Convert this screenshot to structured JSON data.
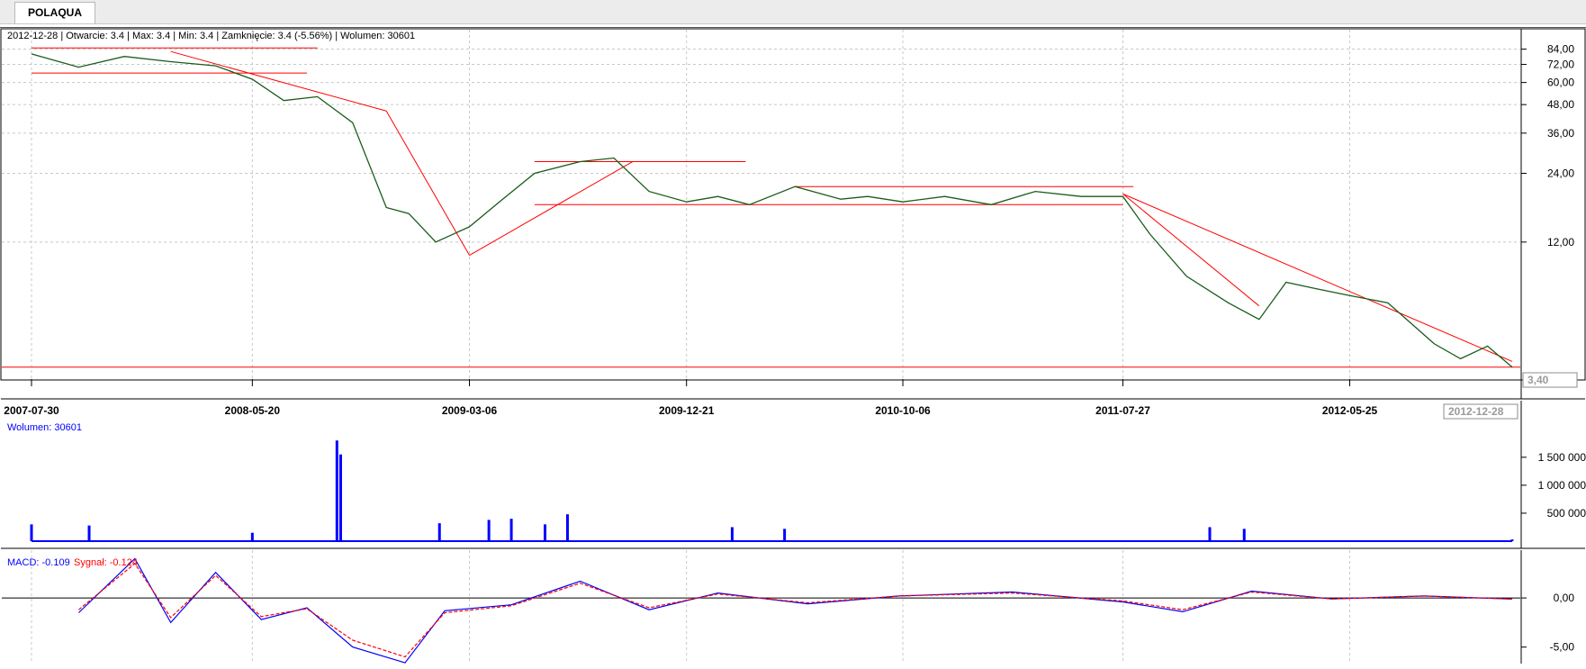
{
  "tab": {
    "label": "POLAQUA"
  },
  "price_panel": {
    "info_line": "2012-12-28 | Otwarcie: 3.4 | Max: 3.4 | Min: 3.4 | Zamknięcie: 3.4 (-5.56%)  | Wolumen: 30601",
    "last_price_label": "3,40",
    "last_date_label": "2012-12-28"
  },
  "volume_panel": {
    "label": "Wolumen: 30601"
  },
  "macd_panel": {
    "macd_label": "MACD: -0.109",
    "signal_label": "Sygnał: -0.124"
  },
  "colors": {
    "price_line": "#1a5c1a",
    "trend_lines": "#ff0000",
    "volume_bars": "#0000ff",
    "volume_avg": "#ff0000",
    "macd_line": "#0000ff",
    "signal_line": "#ff0000",
    "grid": "#c8c8c8"
  },
  "chart_data": [
    {
      "type": "line",
      "name": "price",
      "x_ticks": [
        "2007-07-30",
        "2008-05-20",
        "2009-03-06",
        "2009-12-21",
        "2010-10-06",
        "2011-07-27",
        "2012-05-25"
      ],
      "y_ticks": [
        "84,00",
        "72,00",
        "60,00",
        "48,00",
        "36,00",
        "24,00",
        "12,00"
      ],
      "y_scale": "log",
      "ylim": [
        3.3,
        95
      ],
      "grid": true,
      "x": [
        "2007-07-30",
        "2007-10-01",
        "2007-12-01",
        "2008-02-01",
        "2008-04-01",
        "2008-05-20",
        "2008-07-01",
        "2008-08-15",
        "2008-10-01",
        "2008-11-15",
        "2008-12-15",
        "2009-01-20",
        "2009-03-06",
        "2009-04-15",
        "2009-06-01",
        "2009-08-01",
        "2009-09-15",
        "2009-11-01",
        "2009-12-21",
        "2010-02-01",
        "2010-03-15",
        "2010-05-15",
        "2010-07-15",
        "2010-08-20",
        "2010-10-06",
        "2010-12-01",
        "2011-02-01",
        "2011-04-01",
        "2011-06-01",
        "2011-07-27",
        "2011-09-01",
        "2011-10-20",
        "2011-12-15",
        "2012-01-25",
        "2012-03-01",
        "2012-04-10",
        "2012-05-25",
        "2012-07-15",
        "2012-09-15",
        "2012-10-20",
        "2012-11-25",
        "2012-12-28"
      ],
      "values": [
        80,
        70,
        78,
        74,
        71,
        62,
        50,
        52,
        40,
        17,
        16,
        12,
        14,
        18,
        24,
        27,
        28,
        20,
        18,
        19,
        17.5,
        21,
        18.5,
        19,
        18,
        19,
        17.5,
        20,
        19,
        19,
        13,
        8.5,
        6.5,
        5.5,
        8,
        7.5,
        7,
        6.5,
        4.3,
        3.7,
        4.2,
        3.4
      ]
    },
    {
      "type": "bar",
      "name": "Wolumen",
      "y_ticks": [
        "500 000",
        "1 000 000",
        "1 500 000"
      ],
      "ylim": [
        0,
        1900000
      ],
      "x": [
        "2007-07-30",
        "2007-10-15",
        "2008-05-20",
        "2008-09-10",
        "2008-09-15",
        "2009-01-25",
        "2009-04-01",
        "2009-05-01",
        "2009-06-15",
        "2009-07-15",
        "2010-02-20",
        "2010-05-01",
        "2011-11-20",
        "2012-01-05",
        "2012-12-28"
      ],
      "values": [
        300000,
        280000,
        150000,
        1800000,
        1550000,
        320000,
        380000,
        400000,
        300000,
        480000,
        250000,
        220000,
        250000,
        220000,
        30601
      ]
    },
    {
      "type": "line",
      "name": "MACD",
      "y_ticks": [
        "0,00",
        "-5,00"
      ],
      "ylim": [
        -6.5,
        4.5
      ],
      "x": [
        "2007-10-01",
        "2007-12-15",
        "2008-02-01",
        "2008-04-01",
        "2008-06-01",
        "2008-08-01",
        "2008-10-01",
        "2008-12-10",
        "2009-02-01",
        "2009-05-01",
        "2009-08-01",
        "2009-11-01",
        "2010-02-01",
        "2010-06-01",
        "2010-10-01",
        "2011-03-01",
        "2011-07-27",
        "2011-10-15",
        "2012-01-15",
        "2012-05-01",
        "2012-09-01",
        "2012-12-28"
      ],
      "series": [
        {
          "name": "MACD",
          "values": [
            -1.5,
            4,
            -2.5,
            2.6,
            -2.2,
            -1.0,
            -5.0,
            -6.6,
            -1.3,
            -0.7,
            1.7,
            -1.2,
            0.5,
            -0.6,
            0.2,
            0.6,
            -0.4,
            -1.4,
            0.7,
            -0.1,
            0.2,
            -0.11
          ]
        },
        {
          "name": "Sygnał",
          "values": [
            -1.2,
            3.5,
            -2.0,
            2.3,
            -1.9,
            -1.1,
            -4.3,
            -6.0,
            -1.5,
            -0.8,
            1.5,
            -1.0,
            0.4,
            -0.5,
            0.2,
            0.5,
            -0.3,
            -1.2,
            0.6,
            -0.1,
            0.2,
            -0.12
          ]
        }
      ]
    }
  ]
}
